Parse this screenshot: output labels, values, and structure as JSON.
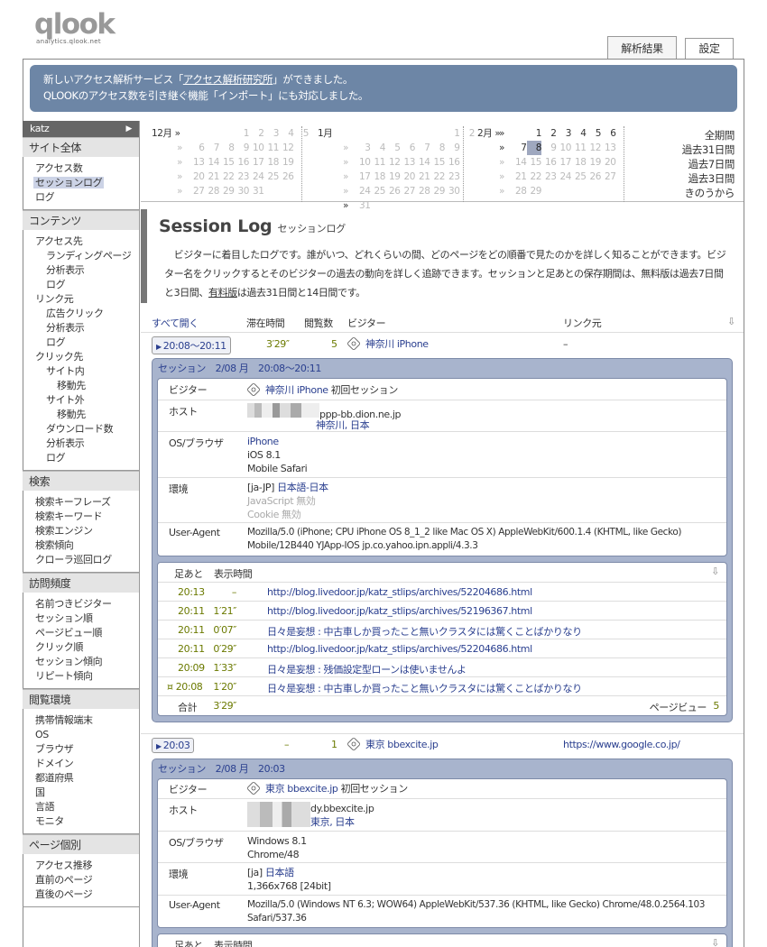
{
  "brand": {
    "logo": "qlook",
    "sub": "analytics.qlook.net"
  },
  "tabs": [
    {
      "label": "解析結果"
    },
    {
      "label": "設定"
    }
  ],
  "notice": {
    "line1_a": "新しいアクセス解析サービス「",
    "line1_link": "アクセス解析研究所",
    "line1_b": "」ができました。",
    "line2": "QLOOKのアクセス数を引き継ぐ機能「インポート」にも対応しました。"
  },
  "sidebar": {
    "user": "katz",
    "user_arrow": "▶",
    "sections": [
      {
        "head": "サイト全体",
        "items": [
          {
            "label": "アクセス数",
            "lv": 1
          },
          {
            "label": "セッションログ",
            "lv": 1,
            "sel": true
          },
          {
            "label": "ログ",
            "lv": 1
          }
        ]
      },
      {
        "head": "コンテンツ",
        "items": [
          {
            "label": "アクセス先",
            "lv": 1
          },
          {
            "label": "ランディングページ",
            "lv": 2
          },
          {
            "label": "分析表示",
            "lv": 2
          },
          {
            "label": "ログ",
            "lv": 2
          },
          {
            "label": "リンク元",
            "lv": 1
          },
          {
            "label": "広告クリック",
            "lv": 2
          },
          {
            "label": "分析表示",
            "lv": 2
          },
          {
            "label": "ログ",
            "lv": 2
          },
          {
            "label": "クリック先",
            "lv": 1
          },
          {
            "label": "サイト内",
            "lv": 2
          },
          {
            "label": "移動先",
            "lv": 3
          },
          {
            "label": "サイト外",
            "lv": 2
          },
          {
            "label": "移動先",
            "lv": 3
          },
          {
            "label": "ダウンロード数",
            "lv": 2
          },
          {
            "label": "分析表示",
            "lv": 2
          },
          {
            "label": "ログ",
            "lv": 2
          }
        ]
      },
      {
        "head": "検索",
        "items": [
          {
            "label": "検索キーフレーズ",
            "lv": 1
          },
          {
            "label": "検索キーワード",
            "lv": 1
          },
          {
            "label": "検索エンジン",
            "lv": 1
          },
          {
            "label": "検索傾向",
            "lv": 1
          },
          {
            "label": "クローラ巡回ログ",
            "lv": 1
          }
        ]
      },
      {
        "head": "訪問頻度",
        "items": [
          {
            "label": "名前つきビジター",
            "lv": 1
          },
          {
            "label": "セッション順",
            "lv": 1
          },
          {
            "label": "ページビュー順",
            "lv": 1
          },
          {
            "label": "クリック順",
            "lv": 1
          },
          {
            "label": "セッション傾向",
            "lv": 1
          },
          {
            "label": "リピート傾向",
            "lv": 1
          }
        ]
      },
      {
        "head": "閲覧環境",
        "items": [
          {
            "label": "携帯情報端末",
            "lv": 1
          },
          {
            "label": "OS",
            "lv": 1
          },
          {
            "label": "ブラウザ",
            "lv": 1
          },
          {
            "label": "ドメイン",
            "lv": 1
          },
          {
            "label": "都道府県",
            "lv": 1
          },
          {
            "label": "国",
            "lv": 1
          },
          {
            "label": "言語",
            "lv": 1
          },
          {
            "label": "モニタ",
            "lv": 1
          }
        ]
      },
      {
        "head": "ページ個別",
        "items": [
          {
            "label": "アクセス推移",
            "lv": 1
          },
          {
            "label": "直前のページ",
            "lv": 1
          },
          {
            "label": "直後のページ",
            "lv": 1
          }
        ]
      }
    ]
  },
  "calendar": {
    "months": [
      {
        "name": "12月 »",
        "rows": [
          [
            "",
            "",
            "",
            "",
            "1",
            "2",
            "3",
            "4",
            "5"
          ],
          [
            "»",
            "6",
            "7",
            "8",
            "9",
            "10",
            "11",
            "12"
          ],
          [
            "»",
            "13",
            "14",
            "15",
            "16",
            "17",
            "18",
            "19"
          ],
          [
            "»",
            "20",
            "21",
            "22",
            "23",
            "24",
            "25",
            "26"
          ],
          [
            "»",
            "27",
            "28",
            "29",
            "30",
            "31",
            "",
            ""
          ]
        ],
        "style": "g"
      },
      {
        "name": "1月",
        "rows": [
          [
            "",
            "",
            "",
            "",
            "",
            "",
            "",
            "1",
            "2"
          ],
          [
            "»",
            "3",
            "4",
            "5",
            "6",
            "7",
            "8",
            "9"
          ],
          [
            "»",
            "10",
            "11",
            "12",
            "13",
            "14",
            "15",
            "16"
          ],
          [
            "»",
            "17",
            "18",
            "19",
            "20",
            "21",
            "22",
            "23"
          ],
          [
            "»",
            "24",
            "25",
            "26",
            "27",
            "28",
            "29",
            "30"
          ],
          [
            "»",
            "31",
            "",
            "",
            "",
            "",
            "",
            ""
          ]
        ],
        "style": "g"
      },
      {
        "name": "2月 »",
        "rows": [
          [
            "»",
            "",
            "1",
            "2",
            "3",
            "4",
            "5",
            "6"
          ],
          [
            "»",
            "7",
            "8",
            "9",
            "10",
            "11",
            "12",
            "13"
          ],
          [
            "»",
            "14",
            "15",
            "16",
            "17",
            "18",
            "19",
            "20"
          ],
          [
            "»",
            "21",
            "22",
            "23",
            "24",
            "25",
            "26",
            "27"
          ],
          [
            "»",
            "28",
            "29",
            "",
            "",
            "",
            "",
            ""
          ]
        ],
        "style": "m"
      }
    ],
    "ranges": [
      "全期間",
      "過去31日間",
      "過去7日間",
      "過去3日間",
      "きのうから"
    ]
  },
  "page": {
    "title": "Session Log",
    "title_jp": "セッションログ",
    "desc_a": "ビジターに着目したログです。誰がいつ、どれくらいの間、どのページをどの順番で見たのかを詳しく知ることができます。ビジター名をクリックするとそのビジターの過去の動向を詳しく追跡できます。セッションと足あとの保存期間は、無料版は過去7日間と3日間、",
    "desc_link": "有料版",
    "desc_b": "は過去31日間と14日間です。"
  },
  "list_header": {
    "expand_all": "すべて開く",
    "stay": "滞在時間",
    "views": "閲覧数",
    "visitor": "ビジター",
    "referrer": "リンク元",
    "dl": "⇩"
  },
  "sessions": [
    {
      "time": "20:08～20:11",
      "stay": "3′29″",
      "views": "5",
      "visitor": "神奈川 iPhone",
      "referrer": "–",
      "panel_title": "セッション　2/08 月　20:08～20:11",
      "visitor_label": "ビジター",
      "visitor_name": "神奈川 iPhone",
      "first": "初回セッション",
      "host_label": "ホスト",
      "host": "ppp-bb.dion.ne.jp",
      "host_loc": "神奈川, 日本",
      "os_label": "OS/ブラウザ",
      "os": [
        "iPhone",
        "iOS 8.1",
        "Mobile Safari"
      ],
      "env_label": "環境",
      "lang_code": "[ja-JP]",
      "lang": "日本語-日本",
      "js": "JavaScript 無効",
      "cookie": "Cookie 無効",
      "ua_label": "User-Agent",
      "ua1": "Mozilla/5.0 (iPhone; CPU iPhone OS 8_1_2 like Mac OS X) AppleWebKit/600.1.4 (KHTML, like Gecko)",
      "ua2": "Mobile/12B440 YJApp-IOS jp.co.yahoo.ipn.appli/4.3.3",
      "fh_time": "足あと",
      "fh_disp": "表示時間",
      "footprints": [
        {
          "t": "20:13",
          "d": "–",
          "p": "http://blog.livedoor.jp/katz_stlips/archives/52204686.html"
        },
        {
          "t": "20:11",
          "d": "1′21″",
          "p": "http://blog.livedoor.jp/katz_stlips/archives/52196367.html"
        },
        {
          "t": "20:11",
          "d": "0′07″",
          "p": "日々是妄想 : 中古車しか買ったこと無いクラスタには驚くことばかりなり"
        },
        {
          "t": "20:11",
          "d": "0′29″",
          "p": "http://blog.livedoor.jp/katz_stlips/archives/52204686.html"
        },
        {
          "t": "20:09",
          "d": "1′33″",
          "p": "日々是妄想 : 残価設定型ローンは使いませんよ"
        },
        {
          "t": "¤ 20:08",
          "d": "1′20″",
          "p": "日々是妄想 : 中古車しか買ったこと無いクラスタには驚くことばかりなり"
        }
      ],
      "total_label": "合計",
      "total": "3′29″",
      "pv_label": "ページビュー",
      "pv": "5"
    },
    {
      "time": "20:03",
      "stay": "–",
      "views": "1",
      "visitor": "東京 bbexcite.jp",
      "referrer": "https://www.google.co.jp/",
      "panel_title": "セッション　2/08 月　20:03",
      "visitor_label": "ビジター",
      "visitor_name": "東京 bbexcite.jp",
      "first": "初回セッション",
      "host_label": "ホスト",
      "host": "dy.bbexcite.jp",
      "host_loc": "東京, 日本",
      "os_label": "OS/ブラウザ",
      "os": [
        "Windows 8.1",
        "Chrome/48"
      ],
      "env_label": "環境",
      "lang_code": "[ja]",
      "lang": "日本語",
      "screen": "1,366x768 [24bit]",
      "ua_label": "User-Agent",
      "ua1": "Mozilla/5.0 (Windows NT 6.3; WOW64) AppleWebKit/537.36 (KHTML, like Gecko) Chrome/48.0.2564.103",
      "ua2": "Safari/537.36",
      "fh_time": "足あと",
      "fh_disp": "表示時間"
    }
  ]
}
